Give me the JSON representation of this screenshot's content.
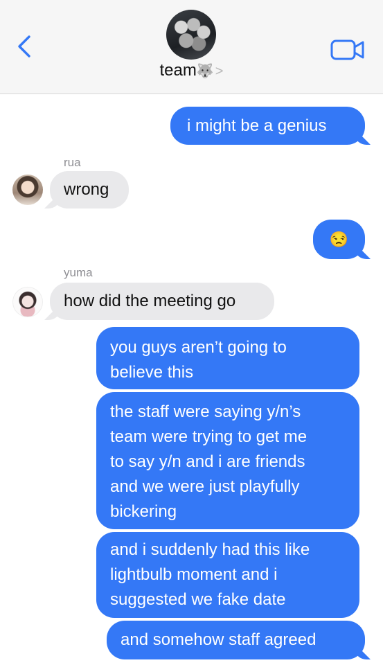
{
  "header": {
    "title": "team",
    "title_emoji": "🐺",
    "title_chevron": ">",
    "back_icon": "chevron-left-icon",
    "video_icon": "video-camera-icon",
    "accent_color": "#3478f6"
  },
  "messages": [
    {
      "direction": "outgoing",
      "text": "i might be a genius"
    },
    {
      "direction": "incoming",
      "sender": "rua",
      "text": "wrong"
    },
    {
      "direction": "outgoing",
      "text": "😒"
    },
    {
      "direction": "incoming",
      "sender": "yuma",
      "text": "how did the meeting go"
    },
    {
      "direction": "outgoing",
      "lines": [
        "you guys aren’t going to",
        "believe this"
      ]
    },
    {
      "direction": "outgoing",
      "lines": [
        "the staff were saying y/n’s",
        "team were trying to get me",
        "to say y/n and i are friends",
        "and we were just playfully",
        "bickering"
      ]
    },
    {
      "direction": "outgoing",
      "lines": [
        "and i suddenly had this like",
        "lightbulb moment and i",
        "suggested we fake date"
      ]
    },
    {
      "direction": "outgoing",
      "text": "and somehow staff agreed"
    }
  ],
  "colors": {
    "outgoing_bubble": "#3478f6",
    "incoming_bubble": "#e9e9eb",
    "sender_label": "#8e8e93"
  }
}
